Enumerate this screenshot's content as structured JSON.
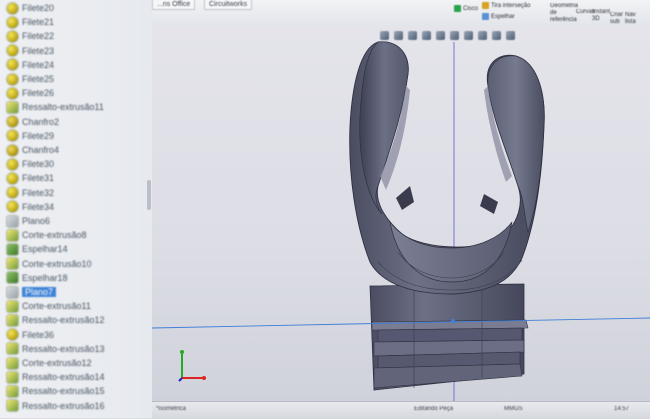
{
  "feature_tree": {
    "items": [
      {
        "label": "Filete20",
        "icon": "fillet-icon"
      },
      {
        "label": "Filete21",
        "icon": "fillet-icon"
      },
      {
        "label": "Filete22",
        "icon": "fillet-icon"
      },
      {
        "label": "Filete23",
        "icon": "fillet-icon"
      },
      {
        "label": "Filete24",
        "icon": "fillet-icon"
      },
      {
        "label": "Filete25",
        "icon": "fillet-icon"
      },
      {
        "label": "Filete26",
        "icon": "fillet-icon"
      },
      {
        "label": "Ressalto-extrusão11",
        "icon": "boss-extrude-icon"
      },
      {
        "label": "Chanfro2",
        "icon": "chamfer-icon"
      },
      {
        "label": "Filete29",
        "icon": "fillet-icon"
      },
      {
        "label": "Chanfro4",
        "icon": "chamfer-icon"
      },
      {
        "label": "Filete30",
        "icon": "fillet-icon"
      },
      {
        "label": "Filete31",
        "icon": "fillet-icon"
      },
      {
        "label": "Filete32",
        "icon": "fillet-icon"
      },
      {
        "label": "Filete34",
        "icon": "fillet-icon"
      },
      {
        "label": "Plano6",
        "icon": "plane-icon"
      },
      {
        "label": "Corte-extrusão8",
        "icon": "cut-extrude-icon"
      },
      {
        "label": "Espelhar14",
        "icon": "mirror-icon"
      },
      {
        "label": "Corte-extrusão10",
        "icon": "cut-extrude-icon"
      },
      {
        "label": "Espelhar18",
        "icon": "mirror-icon"
      },
      {
        "label": "Plano7",
        "icon": "plane-icon",
        "selected": true
      },
      {
        "label": "Corte-extrusão11",
        "icon": "cut-extrude-icon"
      },
      {
        "label": "Ressalto-extrusão12",
        "icon": "boss-extrude-icon"
      },
      {
        "label": "Filete36",
        "icon": "fillet-icon"
      },
      {
        "label": "Ressalto-extrusão13",
        "icon": "boss-extrude-icon"
      },
      {
        "label": "Corte-extrusão12",
        "icon": "cut-extrude-icon"
      },
      {
        "label": "Ressalto-extrusão14",
        "icon": "boss-extrude-icon"
      },
      {
        "label": "Ressalto-extrusão15",
        "icon": "boss-extrude-icon"
      },
      {
        "label": "Ressalto-extrusão16",
        "icon": "boss-extrude-icon"
      }
    ]
  },
  "ribbon": {
    "tabs": [
      "...ns Office",
      "Circuitworks"
    ],
    "buttons": [
      {
        "label": "Cisco",
        "icon": "green-square-icon"
      },
      {
        "label": "Tira interseção",
        "icon": "intersect-icon"
      },
      {
        "label": "Espelhar",
        "icon": "mirror-icon"
      },
      {
        "label": "Geometria de referência",
        "icon": "reference-geometry-icon"
      },
      {
        "label": "Curvas",
        "icon": "curves-icon"
      },
      {
        "label": "Instant 3D",
        "icon": "instant3d-icon"
      },
      {
        "label": "Criar sub",
        "icon": "subfeature-icon"
      },
      {
        "label": "Nav lista",
        "icon": "navigate-icon"
      }
    ]
  },
  "view_toolbar": {
    "icons": [
      "zoom-fit-icon",
      "zoom-area-icon",
      "previous-view-icon",
      "section-view-icon",
      "view-orientation-icon",
      "display-style-icon",
      "hide-show-icon",
      "edit-appearance-icon",
      "apply-scene-icon",
      "view-settings-icon"
    ]
  },
  "model": {
    "color_body": "#6a6d80",
    "color_highlight": "#8b8ea0",
    "color_shadow": "#3f4155",
    "color_edge": "#2f3142"
  },
  "triad": {
    "colors": {
      "x": "#d22",
      "y": "#2a2",
      "z": "#22c"
    }
  },
  "status": {
    "model_label": "*Isométrica",
    "editing_label": "Editando Peça",
    "units": "MMGS",
    "time": "14:57"
  }
}
